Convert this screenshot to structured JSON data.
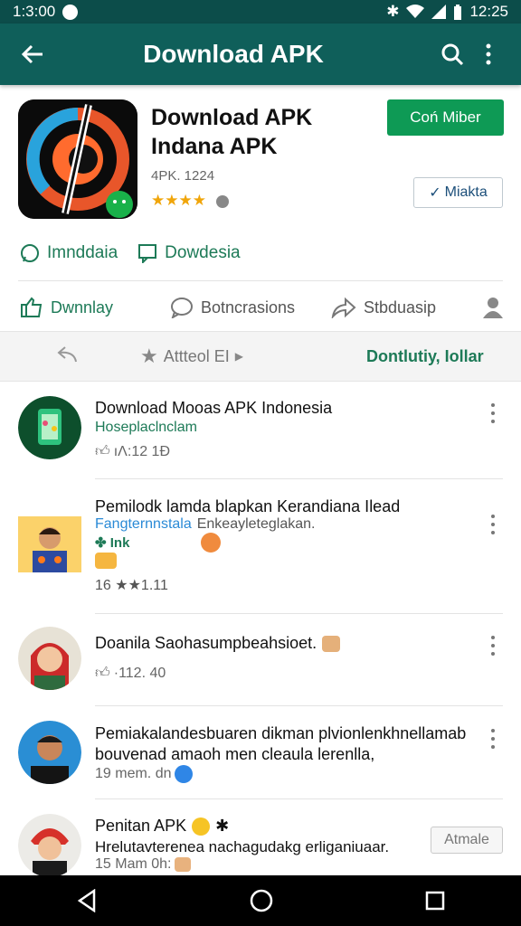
{
  "status_bar": {
    "time_left": "1:3:00",
    "time_right": "12:25"
  },
  "app_bar": {
    "title": "Download APK",
    "back_icon": "arrow-left-icon",
    "search_icon": "search-icon",
    "more_icon": "more-vert-icon"
  },
  "app": {
    "title": "Download APK Indana APK",
    "meta": "4PK. 1224",
    "rating_stars": "★★★★",
    "primary_button": "Coń Miber",
    "secondary_button": "Miakta",
    "accent": "#0e9a55"
  },
  "chips": [
    {
      "label": "Imnddaia",
      "icon": "whatsapp-icon"
    },
    {
      "label": "Dowdesia",
      "icon": "chat-icon"
    }
  ],
  "actions": [
    {
      "label": "Dwnnlay",
      "icon": "thumb-up-icon"
    },
    {
      "label": "Botncrasions",
      "icon": "comment-icon"
    },
    {
      "label": "Stbduasip",
      "icon": "share-icon"
    },
    {
      "label": "",
      "icon": "person-icon"
    }
  ],
  "filter_bar": {
    "sort_label": "Attteol EI",
    "right_label": "Dontlutiy, Iollar"
  },
  "list": [
    {
      "title": "Download Mooas APK Indonesia",
      "subtitle": "Hoseplaclnclam",
      "meta": "ıɅ:12 1Ð"
    },
    {
      "title": "Pemilodk lamda blapkan Kerandiana Ilead",
      "subtitle": "Fangternnstala",
      "subtitle2": "Enkeayleteglakan.",
      "tag": "Ink",
      "meta": "16 ★★1.11"
    },
    {
      "title": "Doanila Saohasumpbeahsioet.",
      "meta": "·112. 40"
    },
    {
      "title": "Pemiakalandesbuaren dikman plvionlenkhnellamab bouvenad amaoh men cleaula lerenlla,",
      "meta": "19 mem. dn"
    },
    {
      "title": "Penitan APK",
      "subtitle": "Hrelutavterenea nachagudakg erliganiuaar.",
      "meta": "15 Mam 0h:",
      "button": "Atmale"
    }
  ]
}
